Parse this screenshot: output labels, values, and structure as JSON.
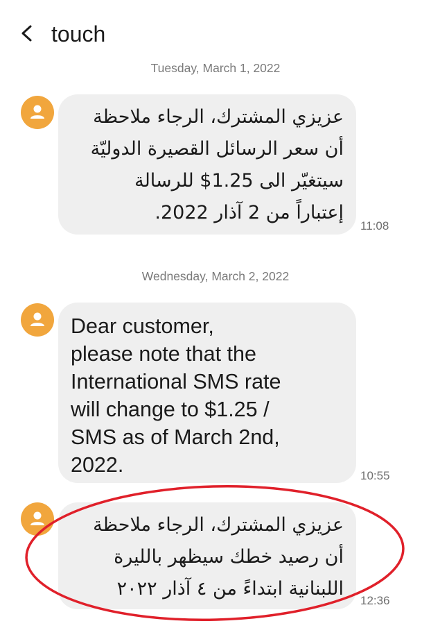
{
  "header": {
    "title": "touch",
    "back_icon": "chevron-left-icon"
  },
  "messages": [
    {
      "date": "Tuesday, March 1, 2022",
      "lines": [
        "عزيزي المشترك، الرجاء ملاحظة",
        "أن سعر الرسائل القصيرة الدوليّة",
        "سيتغيّر الى 1.25$ للرسالة",
        "إعتباراً من 2 آذار 2022."
      ],
      "time": "11:08"
    },
    {
      "date": "Wednesday, March 2, 2022",
      "lines": [
        "Dear customer,",
        "please note that the",
        "International SMS rate",
        "will change to $1.25 /",
        "SMS as of March 2nd,",
        "2022."
      ],
      "time": "10:55"
    },
    {
      "lines": [
        "عزيزي المشترك، الرجاء ملاحظة",
        "أن رصيد خطك سيظهر بالليرة",
        "اللبنانية ابتداءً من ٤ آذار ٢٠٢٢"
      ],
      "time": "12:36"
    }
  ],
  "colors": {
    "avatar": "#f1a63d",
    "bubble": "#efefef",
    "highlight_oval": "#e0202a"
  }
}
